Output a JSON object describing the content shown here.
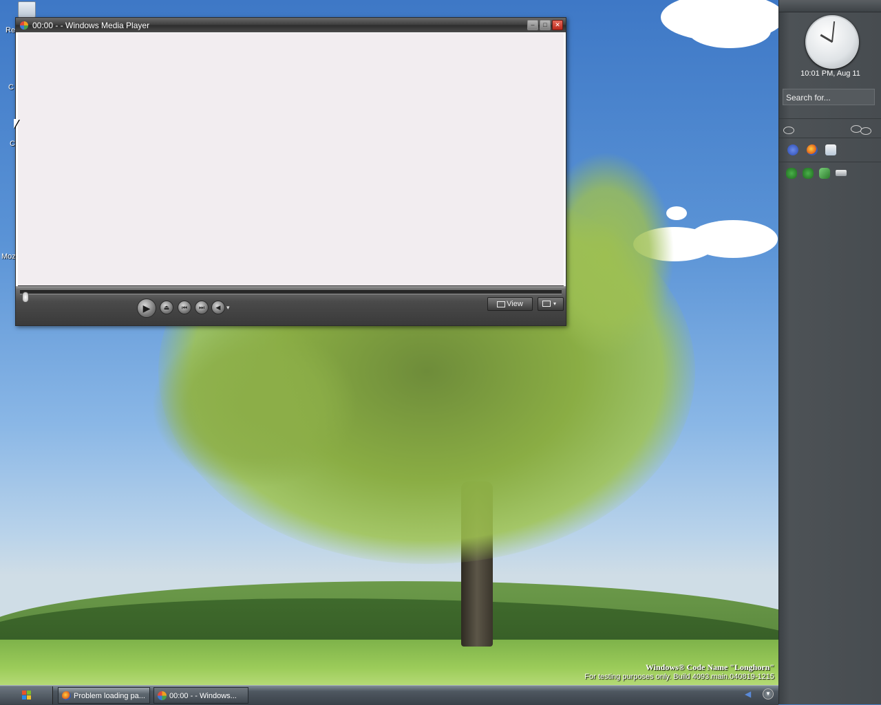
{
  "desktop": {
    "icons": [
      {
        "name": "recycle-bin",
        "label": "Re"
      },
      {
        "name": "computer",
        "label": "C"
      },
      {
        "name": "network",
        "label": "C"
      },
      {
        "name": "mozilla",
        "label": "Moz"
      }
    ],
    "watermark": {
      "line1": "Windows® Code Name \"Longhorn\"",
      "line2": "For testing purposes only. Build 4093.main.040819-1215"
    }
  },
  "wmp": {
    "title": "00:00 -  - Windows Media Player",
    "window_buttons": {
      "minimize": "–",
      "maximize": "□",
      "close": "✕"
    },
    "controls": {
      "play": "▶",
      "eject": "⏏",
      "previous": "⏮",
      "next": "⏭",
      "mute": "◀",
      "volume_arrow": "▾",
      "view_label": "View",
      "mode_arrow": "▾"
    },
    "seek_position": 0
  },
  "sidebar": {
    "clock_text": "10:01 PM, Aug 11",
    "search_placeholder": "Search for...",
    "clock_hour": 10,
    "clock_minute": 1
  },
  "taskbar": {
    "tasks": [
      {
        "label": "Problem loading pa...",
        "active": false
      },
      {
        "label": "00:00 -  - Windows...",
        "active": true
      }
    ]
  },
  "colors": {
    "sidebar_bg": "#474c50",
    "taskbar_bg": "#4e5760",
    "video_bg": "#f2edf0"
  }
}
